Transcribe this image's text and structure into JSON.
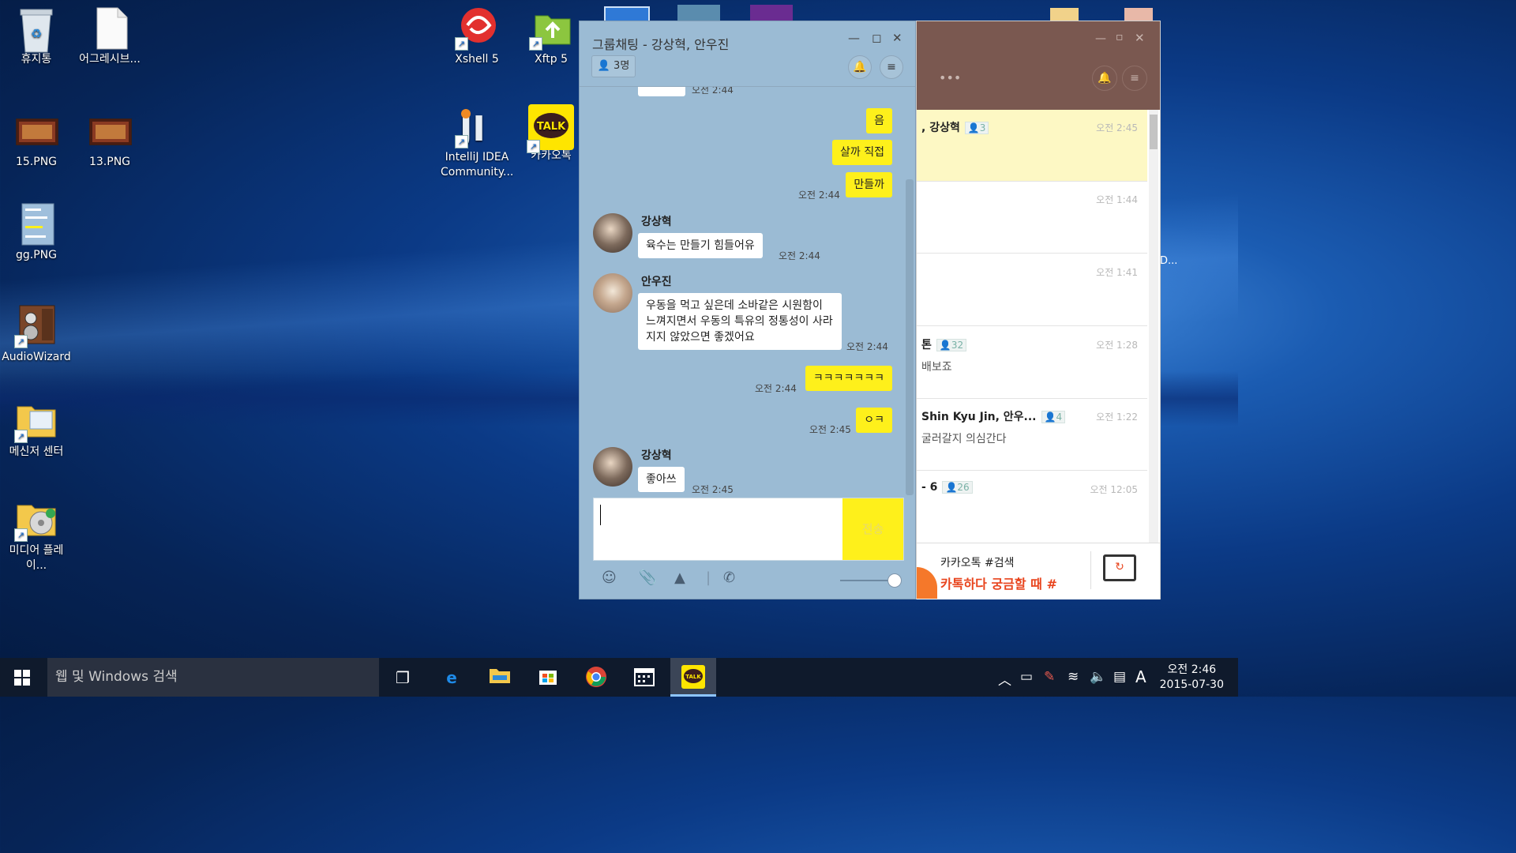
{
  "desktop": {
    "icons": [
      {
        "label": "휴지통"
      },
      {
        "label": "어그레시브..."
      },
      {
        "label": "15.PNG"
      },
      {
        "label": "13.PNG"
      },
      {
        "label": "gg.PNG"
      },
      {
        "label": "AudioWizard"
      },
      {
        "label": "메신저 센터"
      },
      {
        "label": "미디어 플레이..."
      },
      {
        "label": "Xshell 5"
      },
      {
        "label": "Xftp 5"
      },
      {
        "label": "IntelliJ IDEA Community..."
      },
      {
        "label": "카카오톡"
      }
    ]
  },
  "chat": {
    "title": "그룹채팅 - 강상혁, 안우진",
    "member_count": "3명",
    "messages": [
      {
        "sender": "me",
        "text": "음"
      },
      {
        "sender": "me",
        "text": "살까 직접"
      },
      {
        "sender": "me",
        "text": "만들까",
        "time": "오전 2:44"
      },
      {
        "sender": "강상혁",
        "text": "육수는 만들기 힘들어유",
        "time": "오전 2:44"
      },
      {
        "sender": "안우진",
        "text": "우동을 먹고 싶은데 소바같은 시원함이 느껴지면서 우동의 특유의 정통성이 사라지지 않았으면 좋겠어요",
        "time": "오전 2:44"
      },
      {
        "sender": "me",
        "text": "ㅋㅋㅋㅋㅋㅋㅋ",
        "time": "오전 2:44"
      },
      {
        "sender": "me",
        "text": "ㅇㅋ",
        "time": "오전 2:45"
      },
      {
        "sender": "강상혁",
        "text": "좋아쓰",
        "time": "오전 2:45"
      }
    ],
    "top_time": "오전 2:44",
    "send_label": "전송"
  },
  "side": {
    "dots": "•••",
    "rows": [
      {
        "name": ", 강상혁",
        "count": "3",
        "time": "오전 2:45",
        "msg": ""
      },
      {
        "name": "",
        "count": "",
        "time": "오전 1:44",
        "msg": ""
      },
      {
        "name": "",
        "count": "",
        "time": "오전 1:41",
        "msg": ""
      },
      {
        "name": "톤",
        "count": "32",
        "time": "오전 1:28",
        "msg": "배보죠"
      },
      {
        "name": "Shin Kyu Jin, 안우...",
        "count": "4",
        "time": "오전 1:22",
        "msg": "굴러갈지 의심간다"
      },
      {
        "name": "- 6",
        "count": "26",
        "time": "오전 12:05",
        "msg": ""
      }
    ],
    "ad_title": "카카오톡 #검색",
    "ad_sub": "카톡하다 궁금할 때 #",
    "overflow_label": "D..."
  },
  "taskbar": {
    "search_placeholder": "웹 및 Windows 검색",
    "time": "오전 2:46",
    "date": "2015-07-30",
    "ime": "A"
  }
}
